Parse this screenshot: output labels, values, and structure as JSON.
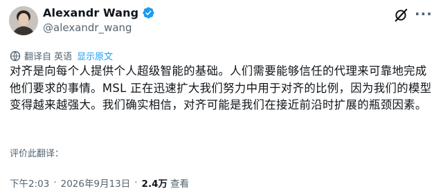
{
  "author": {
    "display_name": "Alexandr Wang",
    "handle": "@alexandr_wang",
    "verified": true,
    "verified_color": "#1d9bf0",
    "avatar_icon": "user-avatar"
  },
  "header_actions": {
    "grok_icon": "grok-icon",
    "more_icon": "more-options-icon"
  },
  "translation": {
    "label": "翻译自 英语",
    "show_original": "显示原文",
    "icon": "translate-icon"
  },
  "tweet": {
    "text": "对齐是向每个人提供个人超级智能的基础。人们需要能够信任的代理来可靠地完成他们要求的事情。MSL 正在迅速扩大我们努力中用于对齐的比例，因为我们的模型变得越来越强大。我们确实相信，对齐可能是我们在接近前沿时扩展的瓶颈因素。"
  },
  "rate_translation": "评价此翻译：",
  "meta": {
    "time": "下午2:03",
    "date": "2026年9月13日",
    "views_count": "2.4万",
    "views_label": "查看"
  },
  "colors": {
    "link_blue": "#1d9bf0",
    "secondary_text": "#536471",
    "primary_text": "#0f1419"
  }
}
